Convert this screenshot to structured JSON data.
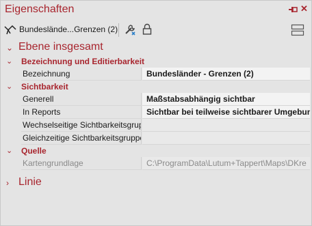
{
  "panel": {
    "title": "Eigenschaften",
    "layer_name": "Bundeslände...Grenzen (2)"
  },
  "sections": {
    "layer": {
      "label": "Ebene insgesamt",
      "expanded": true
    },
    "line": {
      "label": "Linie",
      "expanded": false
    }
  },
  "categories": {
    "naming": "Bezeichnung und Editierbarkeit",
    "visibility": "Sichtbarkeit",
    "source": "Quelle"
  },
  "rows": {
    "bezeichnung": {
      "name": "Bezeichnung",
      "value": "Bundesländer - Grenzen (2)"
    },
    "generell": {
      "name": "Generell",
      "value": "Maßstabsabhängig sichtbar"
    },
    "in_reports": {
      "name": "In Reports",
      "value": "Sichtbar bei teilweise sichtbarer Umgebung"
    },
    "wechselseitige": {
      "name": "Wechselseitige Sichtbarkeitsgruppe",
      "value": ""
    },
    "gleichzeitige": {
      "name": "Gleichzeitige Sichtbarkeitsgruppe",
      "value": ""
    },
    "kartengrundlage": {
      "name": "Kartengrundlage",
      "value": "C:\\ProgramData\\Lutum+Tappert\\Maps\\DKre"
    }
  },
  "colors": {
    "accent": "#a8252e",
    "background": "#e4e4e4",
    "value_background": "#f3f3f3"
  },
  "icons": {
    "title_pin": "pin-icon",
    "title_close": "close-icon",
    "layer": "line-layer-icon",
    "tools": "tools-icon",
    "lock": "lock-icon",
    "view": "view-toggle-icon"
  }
}
